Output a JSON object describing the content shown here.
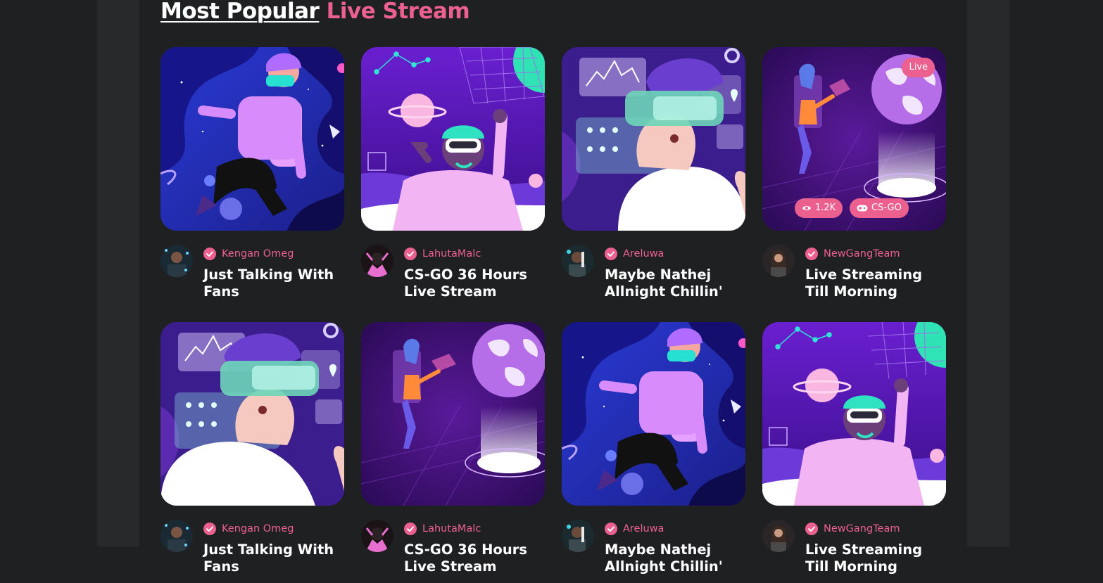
{
  "section": {
    "title_main": "Most Popular",
    "title_accent": "Live Stream"
  },
  "row1": [
    {
      "streamer": "Kengan Omeg",
      "title": "Just Talking With Fans",
      "art": "float-blue"
    },
    {
      "streamer": "LahutaMalc",
      "title": "CS-GO 36 Hours Live Stream",
      "art": "astronaut-purple"
    },
    {
      "streamer": "Areluwa",
      "title": "Maybe Nathej Allnight Chillin'",
      "art": "vr-dashboard"
    },
    {
      "streamer": "NewGangTeam",
      "title": "Live Streaming Till Morning",
      "art": "hologram-globe",
      "live_label": "Live",
      "views": "1.2K",
      "game": "CS-GO"
    }
  ],
  "row2": [
    {
      "streamer": "Kengan Omeg",
      "title": "Just Talking With Fans",
      "art": "vr-dashboard"
    },
    {
      "streamer": "LahutaMalc",
      "title": "CS-GO 36 Hours Live Stream",
      "art": "hologram-globe"
    },
    {
      "streamer": "Areluwa",
      "title": "Maybe Nathej Allnight Chillin'",
      "art": "float-blue"
    },
    {
      "streamer": "NewGangTeam",
      "title": "Live Streaming Till Morning",
      "art": "astronaut-purple"
    }
  ],
  "icons": {
    "verified": "check-circle-icon",
    "views": "eye-icon",
    "game": "gamepad-icon"
  },
  "colors": {
    "accent": "#ec6090",
    "page_bg": "#1f2022",
    "panel_bg": "#27292b"
  }
}
